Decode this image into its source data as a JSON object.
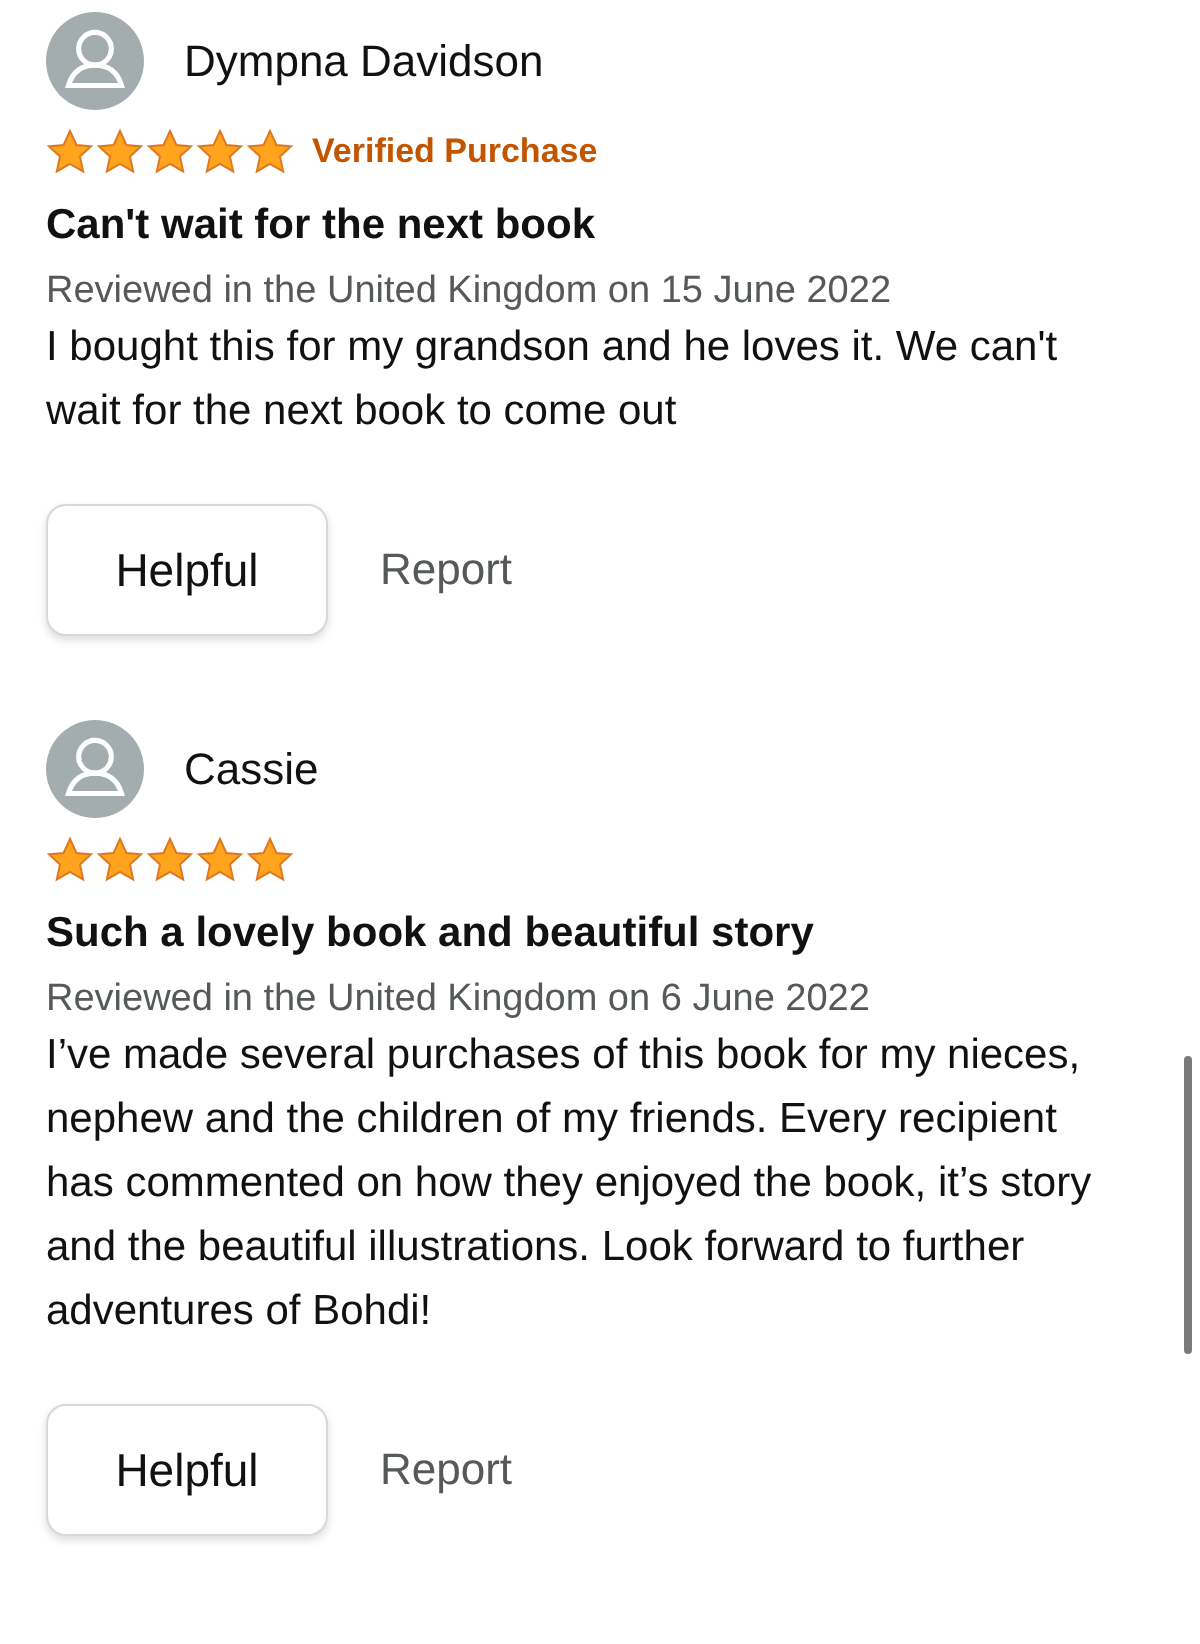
{
  "reviews": [
    {
      "reviewer": "Dympna Davidson",
      "stars": 5,
      "verified": "Verified Purchase",
      "title": "Can't wait for the next book",
      "meta": "Reviewed in the United Kingdom on 15 June 2022",
      "body": "I bought this for my grandson and he loves it. We can't wait for the next book to come out",
      "helpful": "Helpful",
      "report": "Report"
    },
    {
      "reviewer": "Cassie",
      "stars": 5,
      "title": "Such a lovely book and beautiful story",
      "meta": "Reviewed in the United Kingdom on 6 June 2022",
      "body": "I’ve made several purchases of this book for my nieces, nephew and the children of my friends. Every recipient has commented on how they enjoyed the book, it’s story and the beautiful illustrations. Look forward to further adventures of Bohdi!",
      "helpful": "Helpful",
      "report": "Report"
    }
  ]
}
